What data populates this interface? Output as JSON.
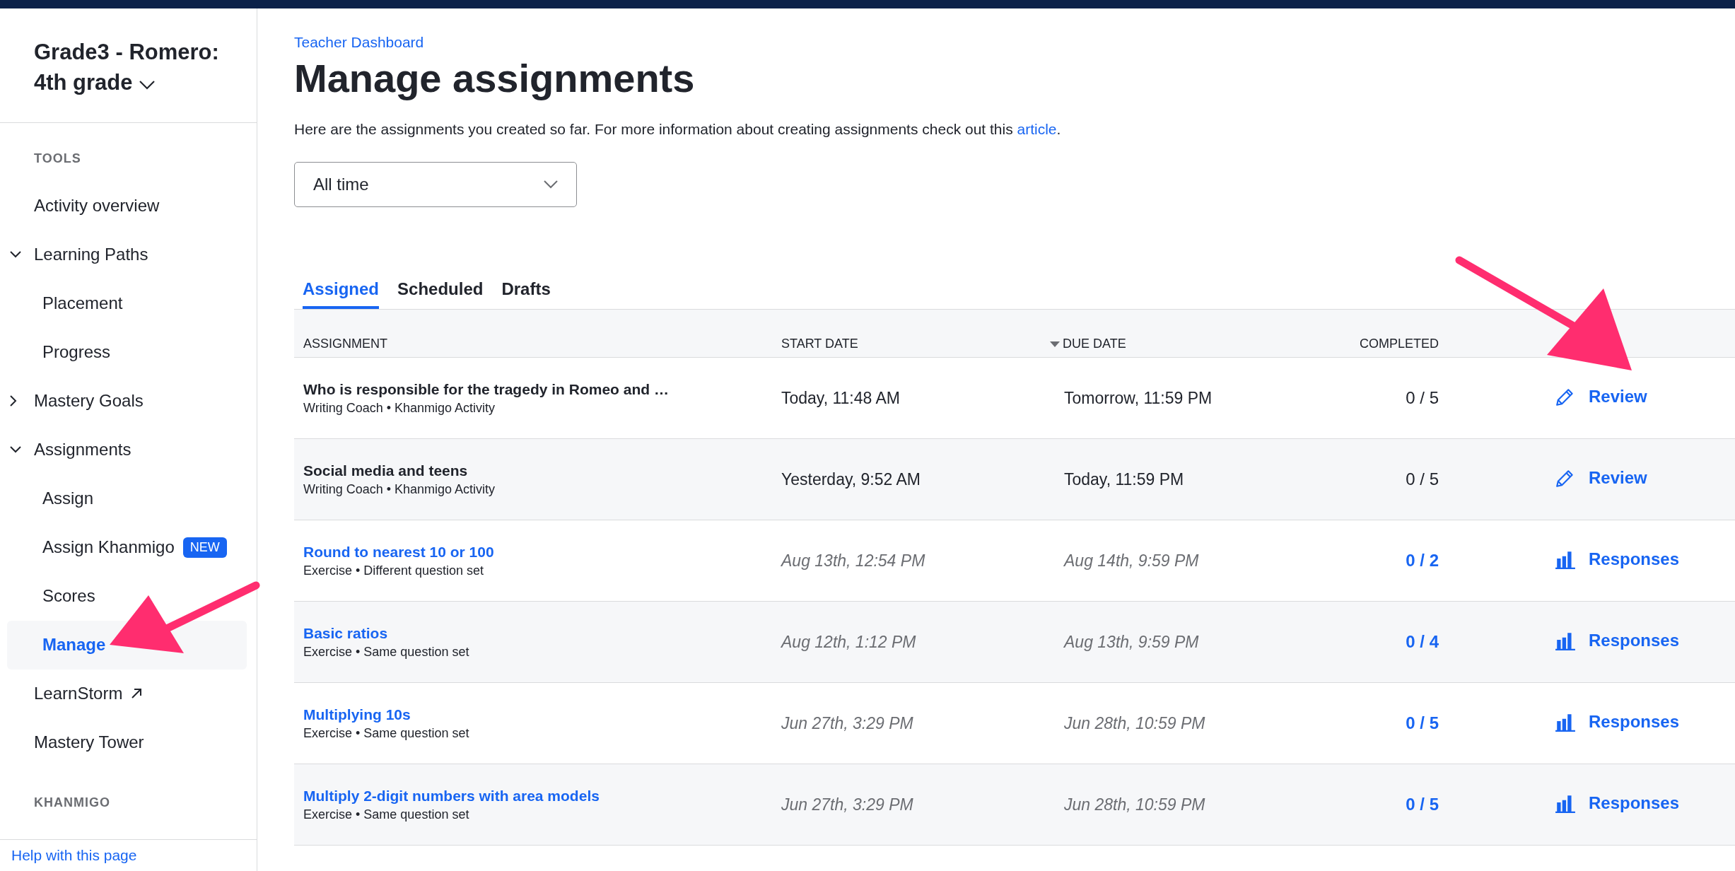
{
  "sidebar": {
    "class_name": "Grade3 - Romero: 4th grade",
    "sections": [
      {
        "heading": "TOOLS",
        "items": [
          {
            "label": "Activity overview",
            "selected": false
          },
          {
            "label": "Learning Paths",
            "selected": false,
            "expanded": true,
            "children": [
              {
                "label": "Placement",
                "selected": false
              },
              {
                "label": "Progress",
                "selected": false
              }
            ]
          },
          {
            "label": "Mastery Goals",
            "selected": false,
            "expanded": false
          },
          {
            "label": "Assignments",
            "selected": false,
            "expanded": true,
            "children": [
              {
                "label": "Assign",
                "selected": false
              },
              {
                "label": "Assign Khanmigo",
                "selected": false,
                "badge": "NEW"
              },
              {
                "label": "Scores",
                "selected": false
              },
              {
                "label": "Manage",
                "selected": true
              }
            ]
          },
          {
            "label": "LearnStorm",
            "selected": false,
            "external": true
          },
          {
            "label": "Mastery Tower",
            "selected": false
          }
        ]
      },
      {
        "heading": "KHANMIGO"
      }
    ],
    "help_link": "Help with this page"
  },
  "breadcrumb": "Teacher Dashboard",
  "title": "Manage assignments",
  "description_parts": [
    "Here are the assignments you created so far. For more information about creating assignments check out this ",
    "article",
    "."
  ],
  "filter": {
    "value": "All time"
  },
  "tabs": [
    {
      "label": "Assigned",
      "selected": true
    },
    {
      "label": "Scheduled",
      "selected": false
    },
    {
      "label": "Drafts",
      "selected": false
    }
  ],
  "table": {
    "columns": [
      {
        "label": "ASSIGNMENT",
        "sorted": false
      },
      {
        "label": "START DATE",
        "sorted": false
      },
      {
        "label": "DUE DATE",
        "sorted": true
      },
      {
        "label": "COMPLETED",
        "sorted": false
      }
    ],
    "rows": [
      {
        "kind": "khanmigo",
        "title": "Who is responsible for the tragedy in Romeo and …",
        "subtitle": "Writing Coach • Khanmigo Activity",
        "start": "Today, 11:48 AM",
        "due": "Tomorrow, 11:59 PM",
        "completed": "0 / 5",
        "action": "Review"
      },
      {
        "kind": "khanmigo",
        "title": "Social media and teens",
        "subtitle": "Writing Coach • Khanmigo Activity",
        "start": "Yesterday, 9:52 AM",
        "due": "Today, 11:59 PM",
        "completed": "0 / 5",
        "action": "Review"
      },
      {
        "kind": "exercise",
        "title": "Round to nearest 10 or 100",
        "subtitle": "Exercise • Different question set",
        "start": "Aug 13th, 12:54 PM",
        "due": "Aug 14th, 9:59 PM",
        "completed": "0 / 2",
        "action": "Responses"
      },
      {
        "kind": "exercise",
        "title": "Basic ratios",
        "subtitle": "Exercise • Same question set",
        "start": "Aug 12th, 1:12 PM",
        "due": "Aug 13th, 9:59 PM",
        "completed": "0 / 4",
        "action": "Responses"
      },
      {
        "kind": "exercise",
        "title": "Multiplying 10s",
        "subtitle": "Exercise • Same question set",
        "start": "Jun 27th, 3:29 PM",
        "due": "Jun 28th, 10:59 PM",
        "completed": "0 / 5",
        "action": "Responses"
      },
      {
        "kind": "exercise",
        "title": "Multiply 2-digit numbers with area models",
        "subtitle": "Exercise • Same question set",
        "start": "Jun 27th, 3:29 PM",
        "due": "Jun 28th, 10:59 PM",
        "completed": "0 / 5",
        "action": "Responses"
      }
    ]
  }
}
